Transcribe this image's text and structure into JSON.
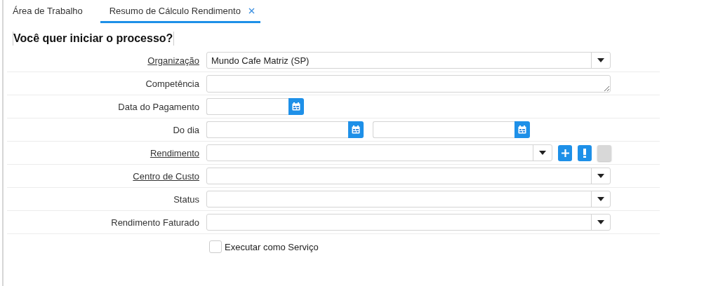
{
  "tabs": [
    {
      "label": "Área de Trabalho",
      "selected": false,
      "closable": false
    },
    {
      "label": "Resumo de Cálculo Rendimento",
      "selected": true,
      "closable": true
    }
  ],
  "heading": "Você quer iniciar o processo?",
  "fields": [
    {
      "label": "Organização",
      "link": true,
      "kind": "select",
      "value": "Mundo Cafe Matriz (SP)"
    },
    {
      "label": "Competência",
      "link": false,
      "kind": "textarea"
    },
    {
      "label": "Data do Pagamento",
      "link": false,
      "kind": "date"
    },
    {
      "label": "Do dia",
      "link": false,
      "kind": "daterange"
    },
    {
      "label": "Rendimento",
      "link": true,
      "kind": "select",
      "actions": [
        {
          "kind": "add",
          "disabled": false
        },
        {
          "kind": "alert",
          "disabled": false
        },
        {
          "kind": "blank",
          "disabled": true
        }
      ]
    },
    {
      "label": "Centro de Custo",
      "link": true,
      "kind": "select"
    },
    {
      "label": "Status",
      "link": false,
      "kind": "select"
    },
    {
      "label": "Rendimento Faturado",
      "link": false,
      "kind": "select"
    }
  ],
  "checkbox": {
    "label": "Executar como Serviço",
    "checked": false
  }
}
